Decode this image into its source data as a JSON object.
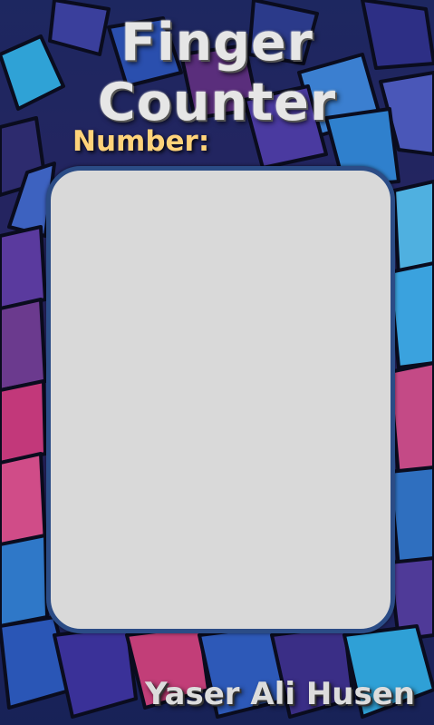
{
  "app": {
    "title": "Finger Counter",
    "number_label": "Number:",
    "number_value": "",
    "author": "Yaser Ali Husen"
  },
  "colors": {
    "title": "#e6e6e6",
    "number_label": "#ffd37a",
    "panel_fill": "#d9d9d9",
    "panel_border": "#2b4c86",
    "author": "#dcdcdc"
  }
}
